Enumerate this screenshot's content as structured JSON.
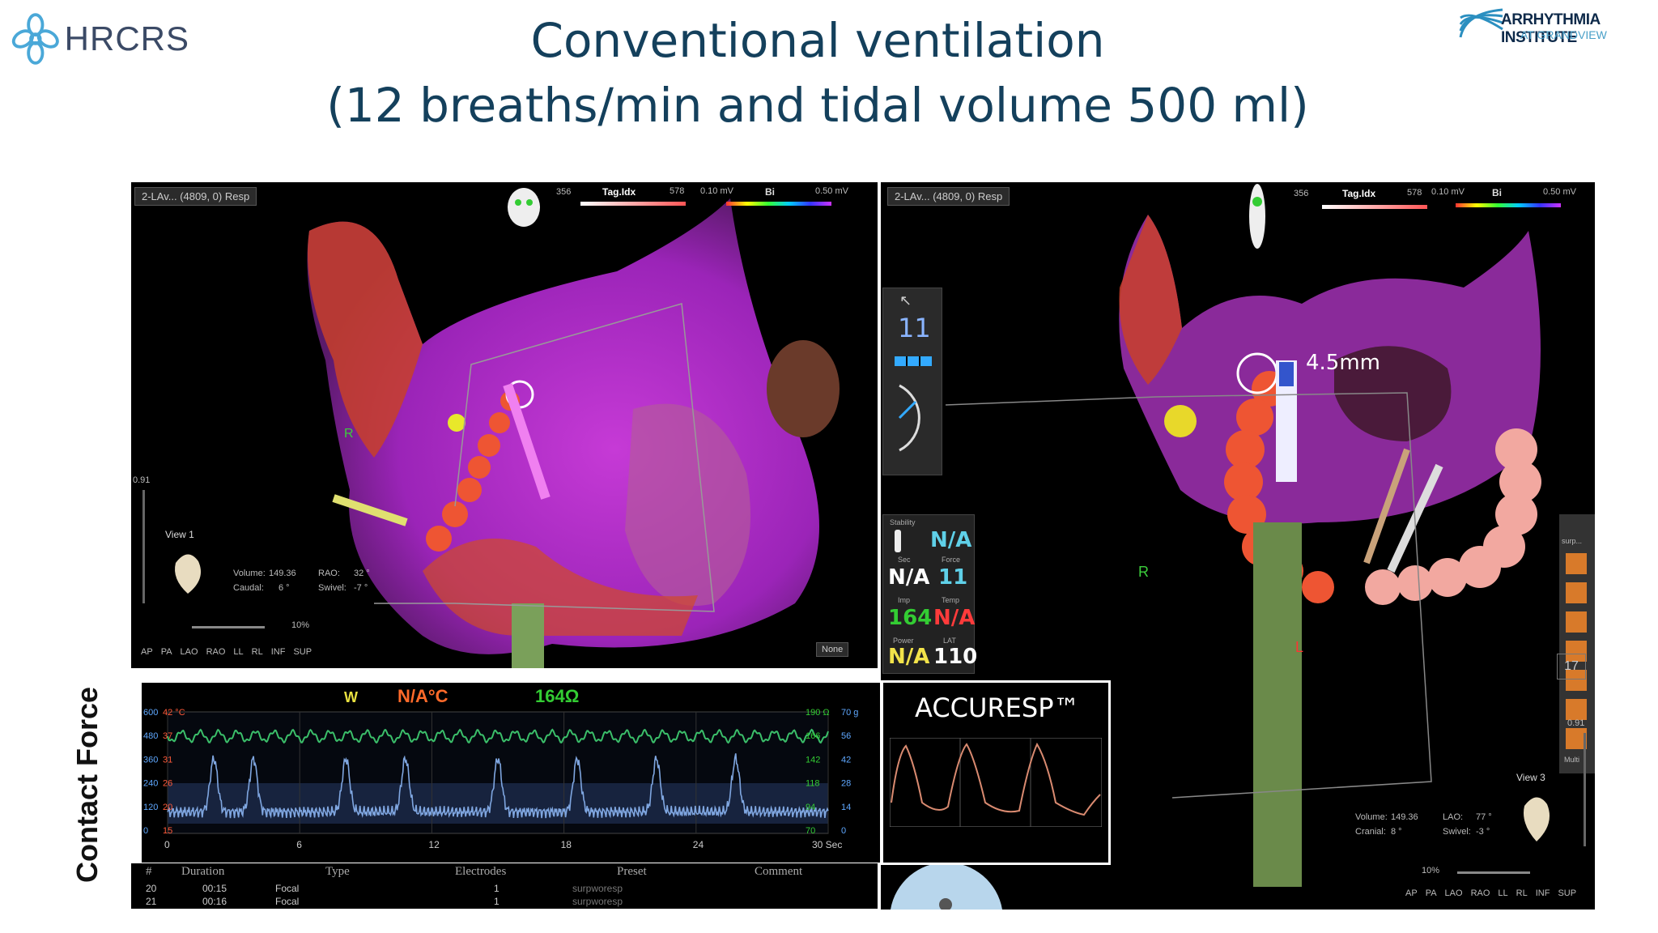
{
  "header": {
    "logo_left_text": "HRCRS",
    "logo_right_line1": "ARRHYTHMIA INSTITUTE",
    "logo_right_line2": "AT GRANDVIEW",
    "title_line1": "Conventional ventilation",
    "title_line2": "(12 breaths/min and tidal volume 500 ml)"
  },
  "left_view": {
    "map_select": "2-LAv... (4809, 0) Resp",
    "tag_min": "356",
    "tag_label": "Tag.Idx",
    "tag_max": "578",
    "volt_min": "0.10 mV",
    "bi_label": "Bi",
    "volt_max": "0.50 mV",
    "view_label": "View 1",
    "scale_top": "0.91",
    "volume_label": "Volume:",
    "volume_value": "149.36",
    "rao_label": "RAO:",
    "rao_value": "32 °",
    "caudal_label": "Caudal:",
    "caudal_value": "6 °",
    "swivel_label": "Swivel:",
    "swivel_value": "-7 °",
    "zoom": "10%",
    "orient_buttons": [
      "AP",
      "PA",
      "LAO",
      "RAO",
      "LL",
      "RL",
      "INF",
      "SUP"
    ],
    "marker_r": "R",
    "none_dropdown": "None"
  },
  "right_view": {
    "map_select": "2-LAv... (4809, 0) Resp",
    "tag_min": "356",
    "tag_label": "Tag.Idx",
    "tag_max": "578",
    "volt_min": "0.10 mV",
    "bi_label": "Bi",
    "volt_max": "0.50 mV",
    "distance": "4.5mm",
    "marker_r": "R",
    "marker_l": "L",
    "view_label": "View 3",
    "scale_top": "0.91",
    "volume_label": "Volume:",
    "volume_value": "149.36",
    "lao_label": "LAO:",
    "lao_value": "77 °",
    "cranial_label": "Cranial:",
    "cranial_value": "8 °",
    "swivel_label": "Swivel:",
    "swivel_value": "-3 °",
    "zoom": "10%",
    "orient_buttons": [
      "AP",
      "PA",
      "LAO",
      "RAO",
      "LL",
      "RL",
      "INF",
      "SUP"
    ],
    "counter": "11",
    "side_counter": "17",
    "side_labels": [
      "surp...",
      "Multi"
    ]
  },
  "stability_panel": {
    "stability_label": "Stability",
    "stability_value": "N/A",
    "sec_label": "Sec",
    "sec_value": "N/A",
    "force_label": "Force",
    "force_value": "11",
    "imp_label": "Imp",
    "imp_value": "164",
    "temp_label": "Temp",
    "temp_value": "N/A",
    "power_label": "Power",
    "power_value": "N/A",
    "lat_label": "LAT",
    "lat_value": "110"
  },
  "contact_force": {
    "side_label": "Contact Force",
    "header_w": "W",
    "header_temp": "N/A°C",
    "header_imp": "164Ω",
    "left_ticks_a": [
      "600",
      "480",
      "360",
      "240",
      "120",
      "0"
    ],
    "left_ticks_b": [
      "42 °C",
      "37",
      "31",
      "26",
      "20",
      "15"
    ],
    "right_ticks_a": [
      "190 Ω",
      "166",
      "142",
      "118",
      "94",
      "70"
    ],
    "right_ticks_b": [
      "70 g",
      "56",
      "42",
      "28",
      "14",
      "0"
    ],
    "x_ticks": [
      "0",
      "6",
      "12",
      "18",
      "24",
      "30 Sec"
    ],
    "accuresp_title": "ACCURESP™"
  },
  "table": {
    "headers": [
      "#",
      "Duration",
      "Type",
      "Electrodes",
      "Preset",
      "Comment"
    ],
    "rows": [
      {
        "id": "20",
        "duration": "00:15",
        "type": "Focal",
        "electrodes": "1",
        "preset": "surpworesp"
      },
      {
        "id": "21",
        "duration": "00:16",
        "type": "Focal",
        "electrodes": "1",
        "preset": "surpworesp"
      }
    ]
  },
  "colors": {
    "title": "#14405c",
    "force_trace": "#7fa6e0",
    "resp_trace": "#3bbf6a",
    "accent_green": "#33cc33",
    "na_cyan": "#5fd0e8",
    "na_red": "#ff3b3b",
    "na_yellow": "#f2e34a"
  }
}
